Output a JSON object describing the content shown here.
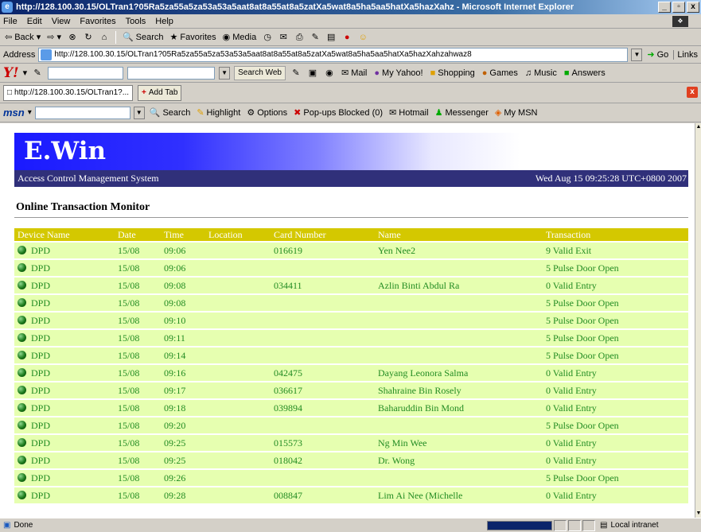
{
  "window": {
    "title": "http://128.100.30.15/OLTran1?05Ra5za55a5za53a53a5aat8at8a55at8a5zatXa5wat8a5ha5aa5hatXa5hazXahz - Microsoft Internet Explorer"
  },
  "menu": [
    "File",
    "Edit",
    "View",
    "Favorites",
    "Tools",
    "Help"
  ],
  "toolbar": {
    "back": "Back",
    "search": "Search",
    "favorites": "Favorites",
    "media": "Media"
  },
  "address": {
    "label": "Address",
    "url": "http://128.100.30.15/OLTran1?05Ra5za55a5za53a53a5aat8at8a55at8a5zatXa5wat8a5ha5aa5hatXa5hazXahzahwaz8",
    "go": "Go",
    "links": "Links"
  },
  "yahoo": {
    "logo": "Y!",
    "search_web": "Search Web",
    "mail": "Mail",
    "my_yahoo": "My Yahoo!",
    "shopping": "Shopping",
    "games": "Games",
    "music": "Music",
    "answers": "Answers"
  },
  "tabs": {
    "current": "http://128.100.30.15/OLTran1?...",
    "add": "Add Tab"
  },
  "msn": {
    "logo": "msn",
    "search": "Search",
    "highlight": "Highlight",
    "options": "Options",
    "popups": "Pop-ups Blocked (0)",
    "hotmail": "Hotmail",
    "messenger": "Messenger",
    "my_msn": "My MSN"
  },
  "page": {
    "brand": "E.Win",
    "subtitle": "Access Control Management System",
    "datetime": "Wed Aug 15 09:25:28 UTC+0800 2007",
    "heading": "Online Transaction Monitor",
    "columns": [
      "Device Name",
      "Date",
      "Time",
      "Location",
      "Card Number",
      "Name",
      "Transaction"
    ],
    "rows": [
      [
        "DPD",
        "15/08",
        "09:06",
        "",
        "016619",
        "Yen Nee2",
        "9 Valid Exit"
      ],
      [
        "DPD",
        "15/08",
        "09:06",
        "",
        "",
        "",
        "5 Pulse Door Open"
      ],
      [
        "DPD",
        "15/08",
        "09:08",
        "",
        "034411",
        "Azlin Binti Abdul Ra",
        "0 Valid Entry"
      ],
      [
        "DPD",
        "15/08",
        "09:08",
        "",
        "",
        "",
        "5 Pulse Door Open"
      ],
      [
        "DPD",
        "15/08",
        "09:10",
        "",
        "",
        "",
        "5 Pulse Door Open"
      ],
      [
        "DPD",
        "15/08",
        "09:11",
        "",
        "",
        "",
        "5 Pulse Door Open"
      ],
      [
        "DPD",
        "15/08",
        "09:14",
        "",
        "",
        "",
        "5 Pulse Door Open"
      ],
      [
        "DPD",
        "15/08",
        "09:16",
        "",
        "042475",
        "Dayang Leonora Salma",
        "0 Valid Entry"
      ],
      [
        "DPD",
        "15/08",
        "09:17",
        "",
        "036617",
        "Shahraine Bin Rosely",
        "0 Valid Entry"
      ],
      [
        "DPD",
        "15/08",
        "09:18",
        "",
        "039894",
        "Baharuddin Bin Mond",
        "0 Valid Entry"
      ],
      [
        "DPD",
        "15/08",
        "09:20",
        "",
        "",
        "",
        "5 Pulse Door Open"
      ],
      [
        "DPD",
        "15/08",
        "09:25",
        "",
        "015573",
        "Ng Min Wee",
        "0 Valid Entry"
      ],
      [
        "DPD",
        "15/08",
        "09:25",
        "",
        "018042",
        "Dr. Wong",
        "0 Valid Entry"
      ],
      [
        "DPD",
        "15/08",
        "09:26",
        "",
        "",
        "",
        "5 Pulse Door Open"
      ],
      [
        "DPD",
        "15/08",
        "09:28",
        "",
        "008847",
        "Lim Ai Nee (Michelle",
        "0 Valid Entry"
      ]
    ]
  },
  "status": {
    "text": "Done",
    "zone": "Local intranet"
  },
  "colors": {
    "header_bg": "#d4c800",
    "row_bg": "#e6ffb0",
    "row_text": "#228b22",
    "banner": "#1a1aff"
  }
}
